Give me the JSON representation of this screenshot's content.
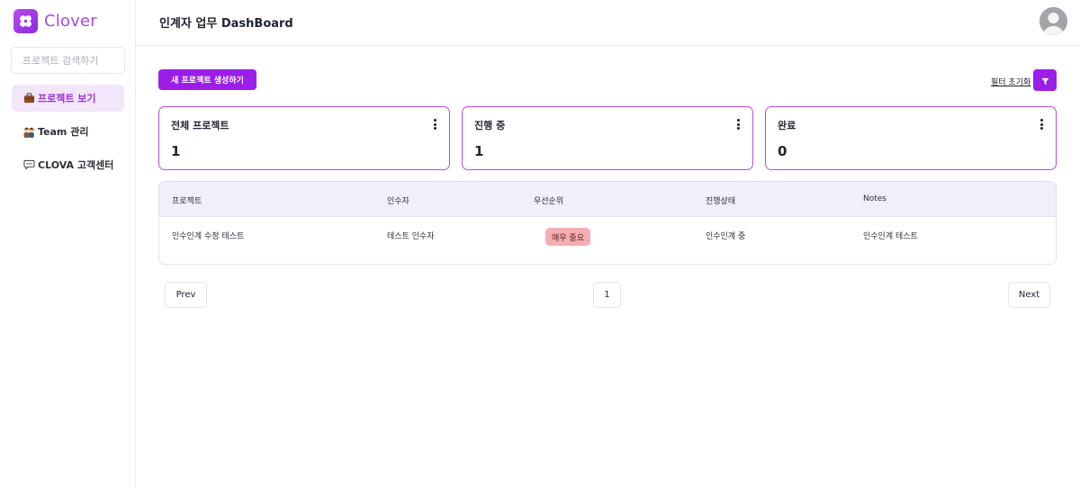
{
  "brand": {
    "name": "Clover"
  },
  "sidebar": {
    "search_placeholder": "프로젝트 검색하기",
    "items": [
      {
        "label": "프로젝트 보기",
        "icon": "briefcase-icon",
        "active": true
      },
      {
        "label": "Team 관리",
        "icon": "team-icon",
        "active": false
      },
      {
        "label": "CLOVA 고객센터",
        "icon": "chat-bubble-icon",
        "active": false
      }
    ]
  },
  "header": {
    "title": "인계자 업무 DashBoard",
    "avatar": "user-avatar-icon"
  },
  "toolbar": {
    "new_project_label": "새 프로젝트 생성하기",
    "reset_filter_label": "필터 초기화",
    "filter_icon": "filter-icon"
  },
  "cards": [
    {
      "title": "전체 프로젝트",
      "value": "1"
    },
    {
      "title": "진행 중",
      "value": "1"
    },
    {
      "title": "완료",
      "value": "0"
    }
  ],
  "table": {
    "headers": [
      "프로젝트",
      "인수자",
      "우선순위",
      "진행상태",
      "Notes"
    ],
    "rows": [
      {
        "project": "인수인계 수정 테스트",
        "assignee": "테스트 인수자",
        "priority": "매우 중요",
        "status": "인수인계 중",
        "notes": "인수인계 테스트"
      }
    ]
  },
  "pagination": {
    "prev_label": "Prev",
    "page": "1",
    "next_label": "Next"
  },
  "colors": {
    "accent": "#9a1ee8",
    "brand": "#a54be8",
    "card_border": "#b24fd9",
    "table_header_bg": "#f2eefb",
    "badge_bg": "#f4aeb0",
    "active_nav_bg": "#f3e6fb"
  }
}
